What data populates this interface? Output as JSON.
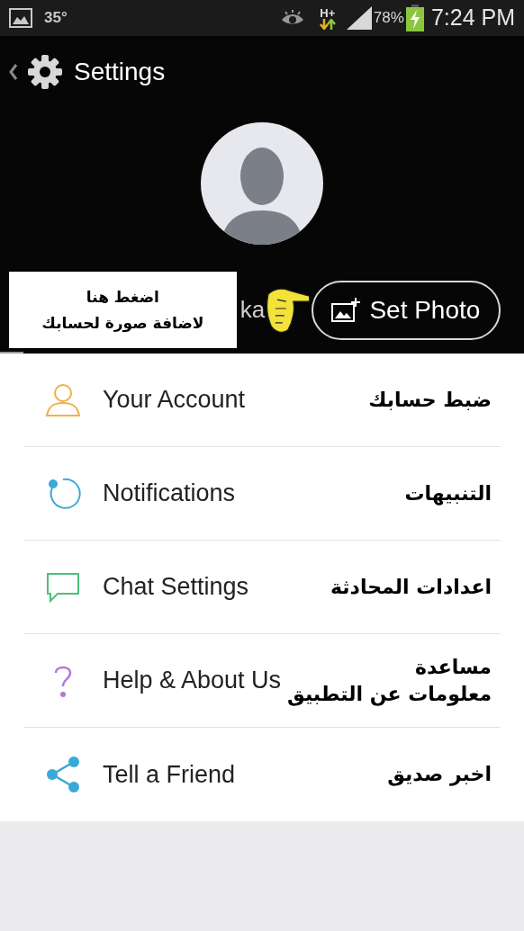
{
  "status_bar": {
    "temperature": "35°",
    "network": "H+",
    "battery": "78%",
    "time": "7:24 PM"
  },
  "action_bar": {
    "title": "Settings"
  },
  "profile": {
    "name": "ka",
    "button": "Set Photo"
  },
  "callout": {
    "lines": [
      "اضغط هنا",
      "لاضافة صورة  لحسابك"
    ]
  },
  "menu": [
    {
      "kind": "account",
      "label": "Your Account",
      "note": [
        "ضبط حسابك"
      ]
    },
    {
      "kind": "notifications",
      "label": "Notifications",
      "note": [
        "التنبيهات"
      ]
    },
    {
      "kind": "chat",
      "label": "Chat Settings",
      "note": [
        "اعدادات المحادثة"
      ]
    },
    {
      "kind": "help",
      "label": "Help & About Us",
      "note": [
        "مساعدة",
        "معلومات عن التطبيق"
      ]
    },
    {
      "kind": "share",
      "label": "Tell a Friend",
      "note": [
        "اخبر صديق"
      ]
    }
  ]
}
